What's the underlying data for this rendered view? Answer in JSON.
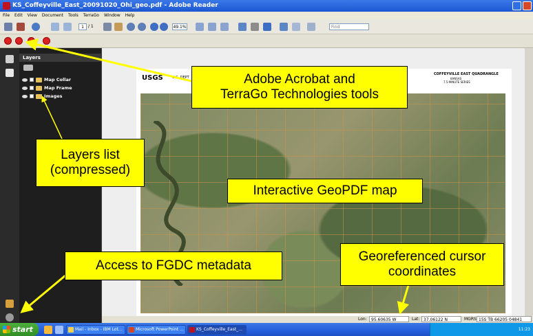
{
  "window": {
    "title": "KS_Coffeyville_East_20091020_Ohi_geo.pdf - Adobe Reader"
  },
  "menubar": {
    "items": [
      "File",
      "Edit",
      "View",
      "Document",
      "Tools",
      "TerraGo",
      "Window",
      "Help"
    ]
  },
  "toolbar": {
    "page_number": "1",
    "page_total": "/ 1",
    "zoom": "49.1%",
    "find_placeholder": "Find"
  },
  "layers_panel": {
    "title": "Layers",
    "items": [
      {
        "label": "Map Collar"
      },
      {
        "label": "Map Frame"
      },
      {
        "label": "Images"
      }
    ]
  },
  "map": {
    "agency": "USGS",
    "agency_line": "U.S. DEPT",
    "quad_title": "COFFEYVILLE EAST QUADRANGLE",
    "quad_state": "KANSAS",
    "quad_series": "7.5-MINUTE SERIES"
  },
  "statusbar": {
    "lon_label": "Lon:",
    "lon_value": "95.60635 W",
    "lat_label": "Lat:",
    "lat_value": "37.06122 N",
    "mgrs_label": "MGRS:",
    "mgrs_value": "15S TB 66205 04841"
  },
  "taskbar": {
    "start": "start",
    "items": [
      {
        "label": "Mail - Inbox - IBM Lot..."
      },
      {
        "label": "Microsoft PowerPoint ..."
      },
      {
        "label": "KS_Coffeyville_East_..."
      }
    ],
    "clock": "11:23"
  },
  "callouts": {
    "tools": [
      "Adobe Acrobat and",
      "TerraGo Technologies tools"
    ],
    "layers": [
      "Layers list",
      "(compressed)"
    ],
    "map": [
      "Interactive GeoPDF map"
    ],
    "metadata": [
      "Access to FGDC metadata"
    ],
    "coords": [
      "Georeferenced cursor",
      "coordinates"
    ]
  },
  "colors": {
    "callout_bg": "#ffff00",
    "arrow": "#ffff00",
    "titlebar": "#1d57d1",
    "taskbar": "#245edb",
    "start": "#2f8d25"
  }
}
